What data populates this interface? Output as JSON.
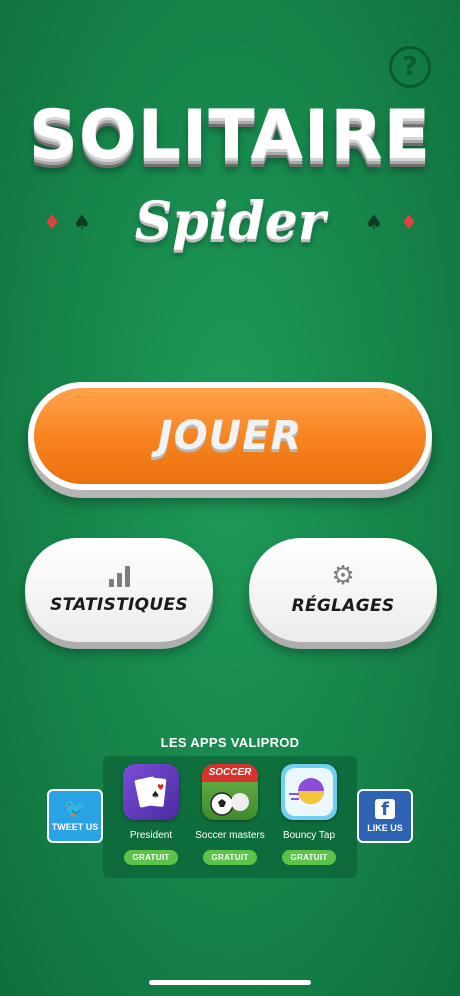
{
  "help": {
    "label": "?"
  },
  "title": {
    "main": "SOLITAIRE",
    "sub": "Spider"
  },
  "suits": {
    "diamond": "♦",
    "spade": "♠"
  },
  "buttons": {
    "play": "JOUER",
    "stats": "STATISTIQUES",
    "settings": "RÉGLAGES"
  },
  "apps": {
    "heading": "LES APPS VALIPROD",
    "items": [
      {
        "name": "President",
        "badge": "GRATUIT"
      },
      {
        "name": "Soccer masters",
        "badge": "GRATUIT",
        "icon_text": "SOCCER"
      },
      {
        "name": "Bouncy Tap",
        "badge": "GRATUIT"
      }
    ]
  },
  "social": {
    "twitter": "TWEET US",
    "facebook": "LIKE US"
  },
  "colors": {
    "background": "#17884c",
    "play_orange": "#f7821f",
    "twitter_blue": "#2aa3e6",
    "facebook_blue": "#2e63b4",
    "badge_green": "#5cc34a"
  }
}
